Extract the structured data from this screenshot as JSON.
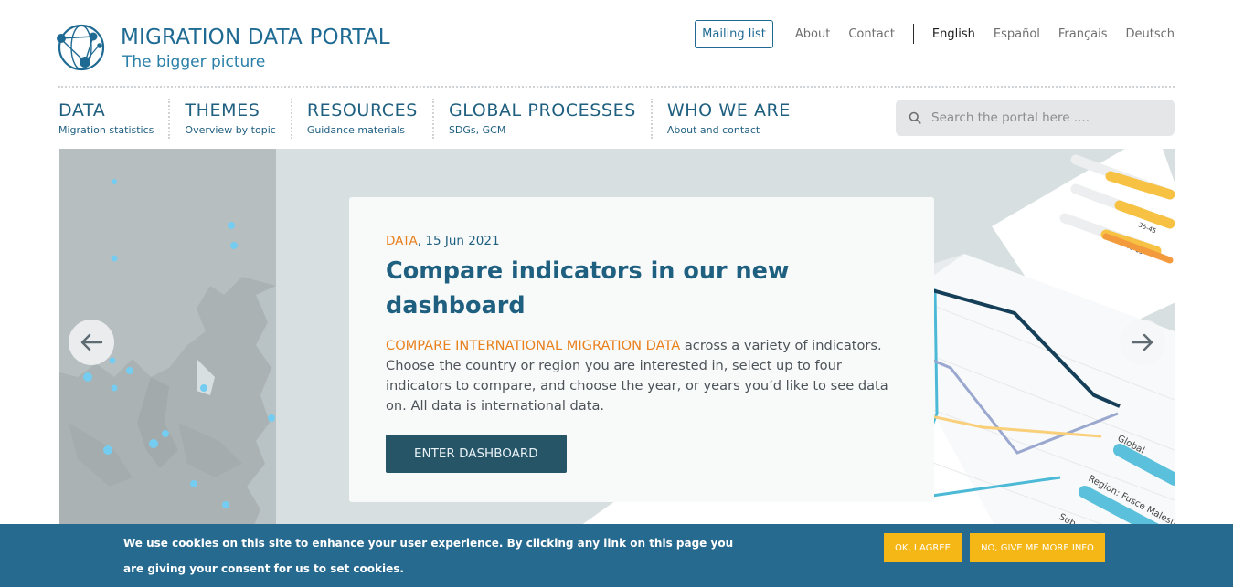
{
  "brand": {
    "title": "MIGRATION DATA PORTAL",
    "tagline": "The bigger picture",
    "logo_icon": "network-globe-icon",
    "color": "#1f6a93"
  },
  "top_links": {
    "mailing": "Mailing list",
    "about": "About",
    "contact": "Contact"
  },
  "languages": [
    "English",
    "Español",
    "Français",
    "Deutsch"
  ],
  "nav": [
    {
      "title": "DATA",
      "sub": "Migration statistics"
    },
    {
      "title": "THEMES",
      "sub": "Overview by topic"
    },
    {
      "title": "RESOURCES",
      "sub": "Guidance materials"
    },
    {
      "title": "GLOBAL PROCESSES",
      "sub": "SDGs, GCM"
    },
    {
      "title": "WHO WE ARE",
      "sub": "About and contact"
    }
  ],
  "search": {
    "placeholder": "Search the portal here ....",
    "icon": "search-icon"
  },
  "hero": {
    "category": "DATA",
    "date": ", 15 Jun 2021",
    "title": "Compare indicators in our new dashboard",
    "body_highlight": "COMPARE INTERNATIONAL MIGRATION DATA",
    "body_rest": " across a variety of indicators. Choose the country or region you are interested in, select up to four indicators to compare, and choose the year, or years you’d like to see data on. All data is international data.",
    "cta": "ENTER DASHBOARD",
    "prev_icon": "arrow-left-icon",
    "next_icon": "arrow-right-icon",
    "art_labels": [
      "36-45",
      "46-65",
      "Global",
      "Region: Fusce Malesuada",
      "Sub"
    ]
  },
  "cookie": {
    "text": "We use cookies on this site to enhance your user experience. By clicking any link on this page you are giving your consent for us to set cookies.",
    "ok": "OK, I AGREE",
    "more": "NO, GIVE ME MORE INFO"
  },
  "colors": {
    "accent_orange": "#e8801e",
    "banner": "#276a8f",
    "cookie_button": "#f5b716",
    "cta": "#275568"
  }
}
